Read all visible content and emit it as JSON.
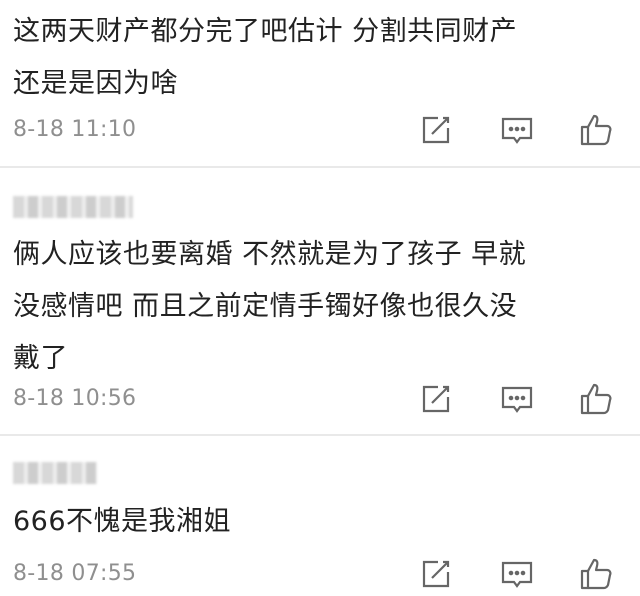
{
  "comments": [
    {
      "text_lines": [
        "这两天财产都分完了吧估计 分割共同财产",
        "还是是因为啥"
      ],
      "time": "8-18 11:10"
    },
    {
      "username": "",
      "text_lines": [
        "俩人应该也要离婚 不然就是为了孩子 早就",
        "没感情吧 而且之前定情手镯好像也很久没",
        "戴了"
      ],
      "time": "8-18 10:56"
    },
    {
      "username": "",
      "text_lines": [
        "666不愧是我湘姐"
      ],
      "time": "8-18 07:55"
    }
  ],
  "icons": {
    "edit": "edit-icon",
    "reply": "comment-icon",
    "like": "thumbs-up-icon"
  },
  "colors": {
    "text": "#222222",
    "meta": "#8f8f8f",
    "icon": "#666666",
    "divider": "#e9e9e9"
  }
}
